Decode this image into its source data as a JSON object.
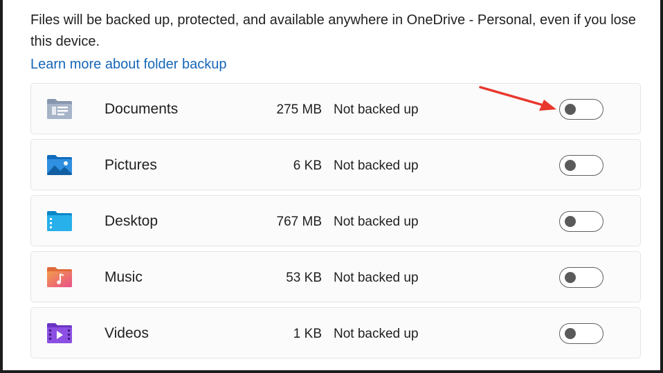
{
  "description": "Files will be backed up, protected, and available anywhere in OneDrive - Personal, even if you lose this device.",
  "learn_more_link": "Learn more about folder backup",
  "folders": [
    {
      "name": "Documents",
      "size": "275 MB",
      "status": "Not backed up",
      "icon": "documents-folder-icon",
      "backed_up": false
    },
    {
      "name": "Pictures",
      "size": "6 KB",
      "status": "Not backed up",
      "icon": "pictures-folder-icon",
      "backed_up": false
    },
    {
      "name": "Desktop",
      "size": "767 MB",
      "status": "Not backed up",
      "icon": "desktop-folder-icon",
      "backed_up": false
    },
    {
      "name": "Music",
      "size": "53 KB",
      "status": "Not backed up",
      "icon": "music-folder-icon",
      "backed_up": false
    },
    {
      "name": "Videos",
      "size": "1 KB",
      "status": "Not backed up",
      "icon": "videos-folder-icon",
      "backed_up": false
    }
  ],
  "colors": {
    "link": "#1566b8",
    "annotation_arrow": "#e8372c",
    "toggle_off": "#5a5a5a"
  }
}
